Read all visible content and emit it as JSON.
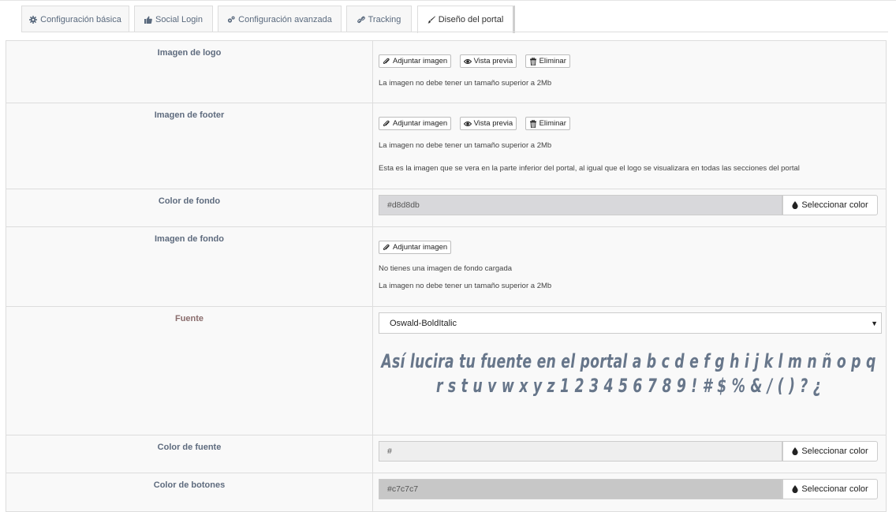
{
  "tabs": [
    {
      "label": "Configuración básica",
      "icon": "gear-icon"
    },
    {
      "label": "Social Login",
      "icon": "thumbs-up-icon"
    },
    {
      "label": "Configuración avanzada",
      "icon": "gears-icon"
    },
    {
      "label": "Tracking",
      "icon": "link-icon"
    },
    {
      "label": "Diseño del portal",
      "icon": "brush-icon",
      "active": true
    }
  ],
  "buttons": {
    "attach": "Adjuntar imagen",
    "preview": "Vista previa",
    "delete": "Eliminar",
    "select_color": "Seleccionar color"
  },
  "rows": {
    "logo": {
      "label": "Imagen de logo",
      "note": "La imagen no debe tener un tamaño superior a 2Mb"
    },
    "footer": {
      "label": "Imagen de footer",
      "note": "La imagen no debe tener un tamaño superior a 2Mb",
      "note2": "Esta es la imagen que se vera en la parte inferior del portal, al igual que el logo se visualizara en todas las secciones del portal"
    },
    "bg_color": {
      "label": "Color de fondo",
      "value": "#d8d8db",
      "swatch": "#d8d8db"
    },
    "bg_image": {
      "label": "Imagen de fondo",
      "note": "No tienes una imagen de fondo cargada",
      "note2": "La imagen no debe tener un tamaño superior a 2Mb"
    },
    "font": {
      "label": "Fuente",
      "selected": "Oswald-BoldItalic",
      "preview": "Así lucira tu fuente en el portal a b c d e f g h i j k l m n ñ o p q r s t u v w x y z 1 2 3 4 5 6 7 8 9 ! # $ % & / ( ) ? ¿"
    },
    "font_color": {
      "label": "Color de fuente",
      "value": "#",
      "swatch": "#eeeeee"
    },
    "button_color": {
      "label": "Color de botones",
      "value": "#c7c7c7",
      "swatch": "#c7c7c7"
    }
  },
  "colors": {
    "label_text": "#5e6b7e",
    "label_accent": "#8a6d6d",
    "preview_text": "#67768a"
  }
}
